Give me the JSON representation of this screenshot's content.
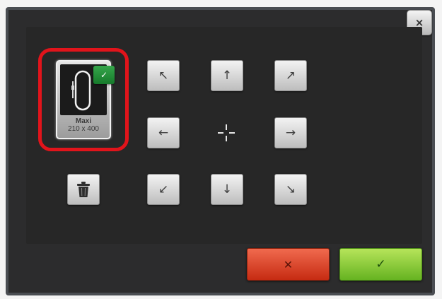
{
  "dialog": {
    "close_glyph": "×",
    "close_icon": "close-icon"
  },
  "hoop": {
    "name": "Maxi",
    "size": "210 x 400",
    "selected_glyph": "✓",
    "selected_icon": "check-icon",
    "selected": true
  },
  "delete": {
    "icon": "trash-icon"
  },
  "move_pad": {
    "up_left": "↖",
    "up": "↑",
    "up_right": "↗",
    "left": "←",
    "right": "→",
    "down_left": "↙",
    "down": "↓",
    "down_right": "↘",
    "center_icon": "crosshair-icon"
  },
  "footer": {
    "cancel_glyph": "✕",
    "confirm_glyph": "✓",
    "cancel_color": "#d9391d",
    "confirm_color": "#8ccc33"
  },
  "colors": {
    "highlight": "#e1141b",
    "badge": "#1f8e36",
    "panel": "#2c2c2d"
  }
}
